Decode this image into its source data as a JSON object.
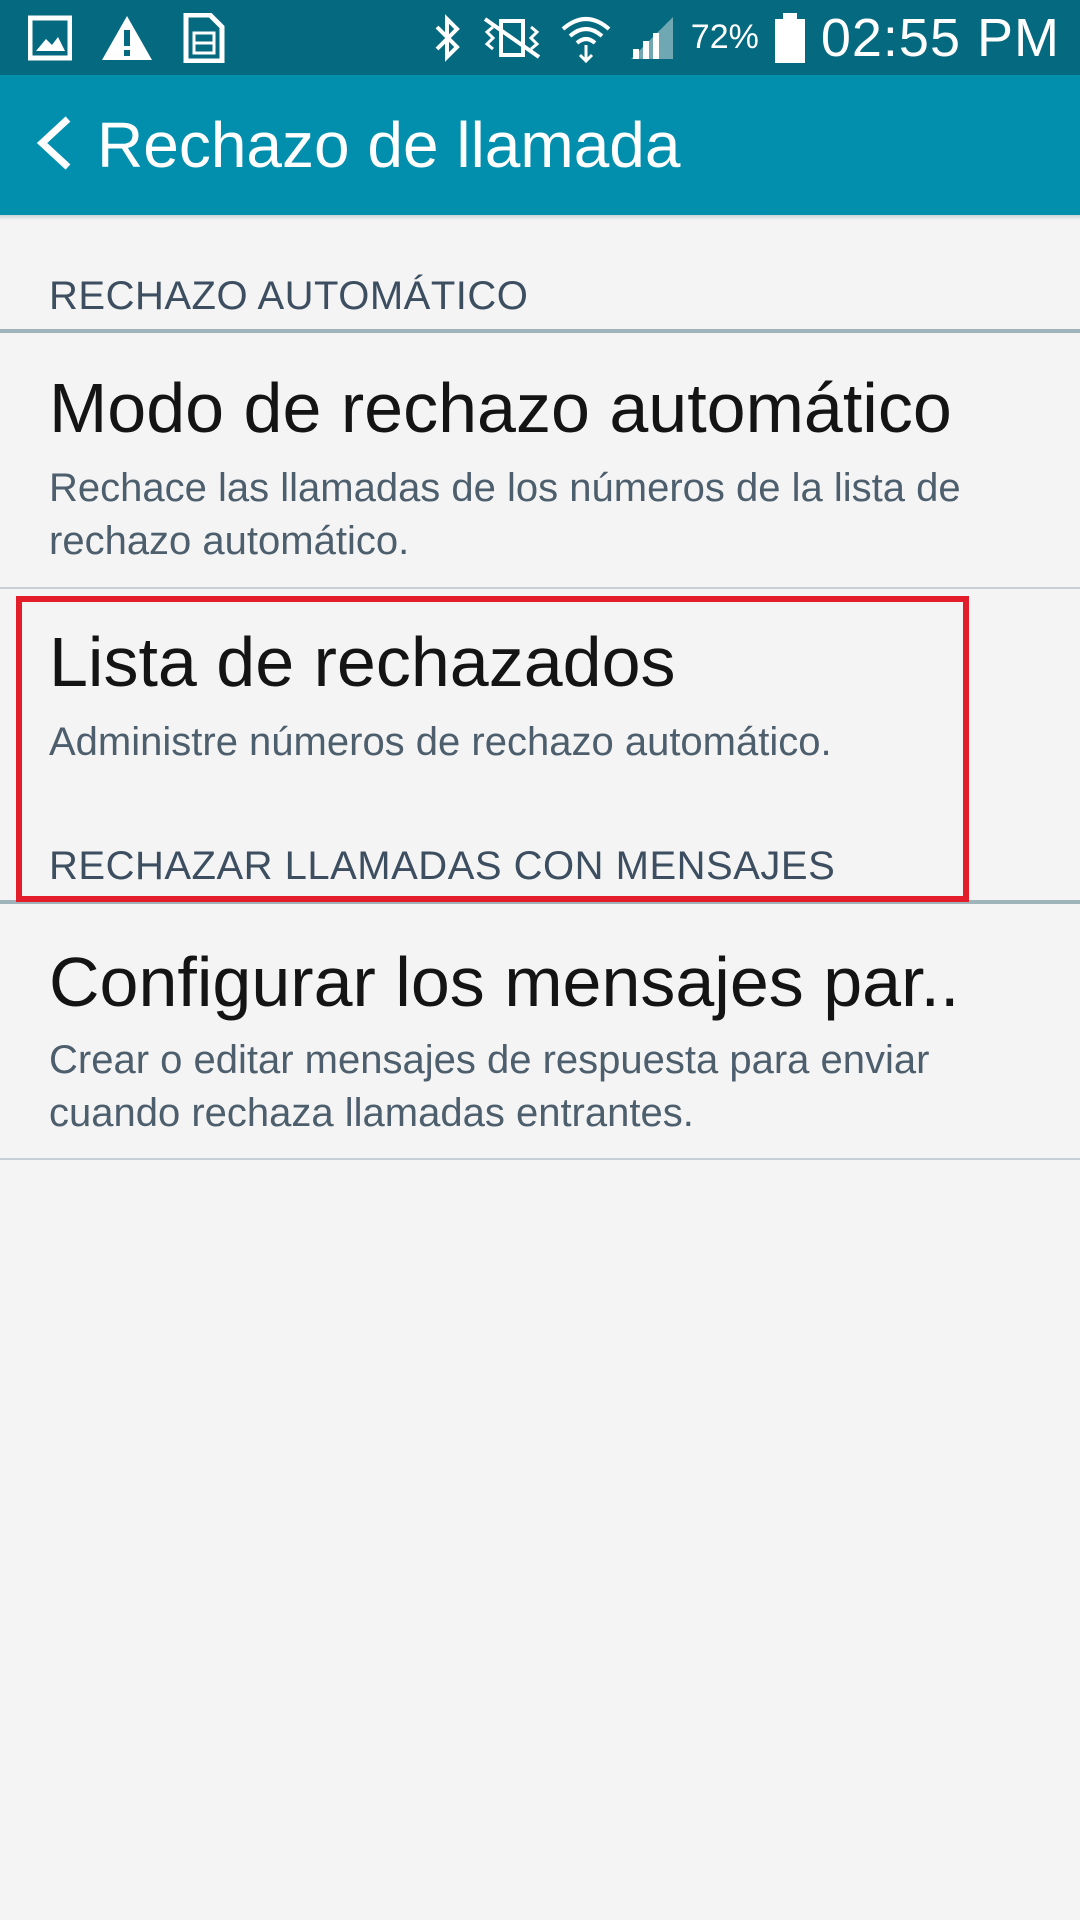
{
  "status_bar": {
    "left_icons": [
      "gallery-icon",
      "warning-icon",
      "sim-card-icon"
    ],
    "right_icons": [
      "bluetooth-icon",
      "vibrate-mute-icon",
      "wifi-icon",
      "signal-icon"
    ],
    "battery_percent": "72%",
    "time": "02:55 PM"
  },
  "app_bar": {
    "back_icon": "chevron-left-icon",
    "title": "Rechazo de llamada"
  },
  "sections": [
    {
      "header": "RECHAZO AUTOMÁTICO",
      "items": [
        {
          "title": "Modo de rechazo automático",
          "summary": "Rechace las llamadas de los números de la lista de rechazo automático."
        },
        {
          "title": "Lista de rechazados",
          "summary": "Administre números de rechazo automático."
        }
      ]
    },
    {
      "header": "RECHAZAR LLAMADAS CON MENSAJES",
      "items": [
        {
          "title": "Configurar los mensajes par..",
          "summary": "Crear o editar mensajes de respuesta para enviar cuando rechaza llamadas entrantes."
        }
      ]
    }
  ],
  "colors": {
    "status_bar": "#056a7f",
    "app_bar": "#028fae",
    "background": "#f4f4f4",
    "highlight": "#e31e2a"
  }
}
